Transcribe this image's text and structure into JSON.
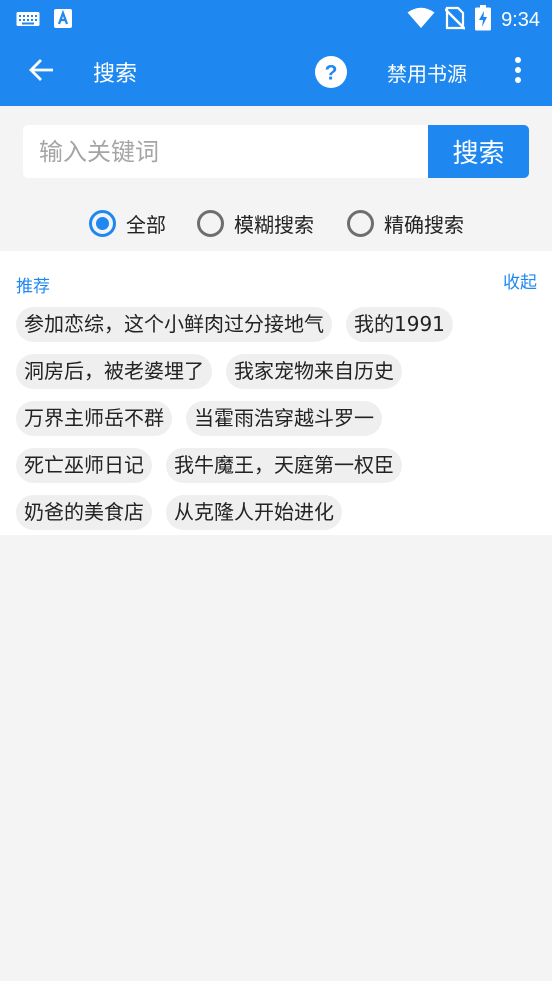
{
  "colors": {
    "primary": "#1e88f0",
    "background": "#f4f4f4",
    "panel": "#ffffff",
    "tag_bg": "#efefef"
  },
  "status_bar": {
    "time": "9:34",
    "icons": [
      "keyboard-icon",
      "a-notification-icon",
      "wifi-icon",
      "no-sim-icon",
      "battery-charging-icon"
    ]
  },
  "toolbar": {
    "back_icon": "arrow-left-icon",
    "title": "搜索",
    "help_icon": "help-circle-icon",
    "disable_source_label": "禁用书源",
    "more_icon": "more-vert-icon"
  },
  "search": {
    "placeholder": "输入关键词",
    "value": "",
    "button_label": "搜索"
  },
  "modes": {
    "selected": "全部",
    "options": [
      "全部",
      "模糊搜索",
      "精确搜索"
    ]
  },
  "recommend": {
    "title": "推荐",
    "collapse_label": "收起",
    "tags": [
      [
        "参加恋综，这个小鲜肉过分接地气",
        "我的1991"
      ],
      [
        "洞房后，被老婆埋了",
        "我家宠物来自历史"
      ],
      [
        "万界主师岳不群",
        "当霍雨浩穿越斗罗一"
      ],
      [
        "死亡巫师日记",
        "我牛魔王，天庭第一权臣"
      ],
      [
        "奶爸的美食店",
        "从克隆人开始进化"
      ]
    ]
  }
}
